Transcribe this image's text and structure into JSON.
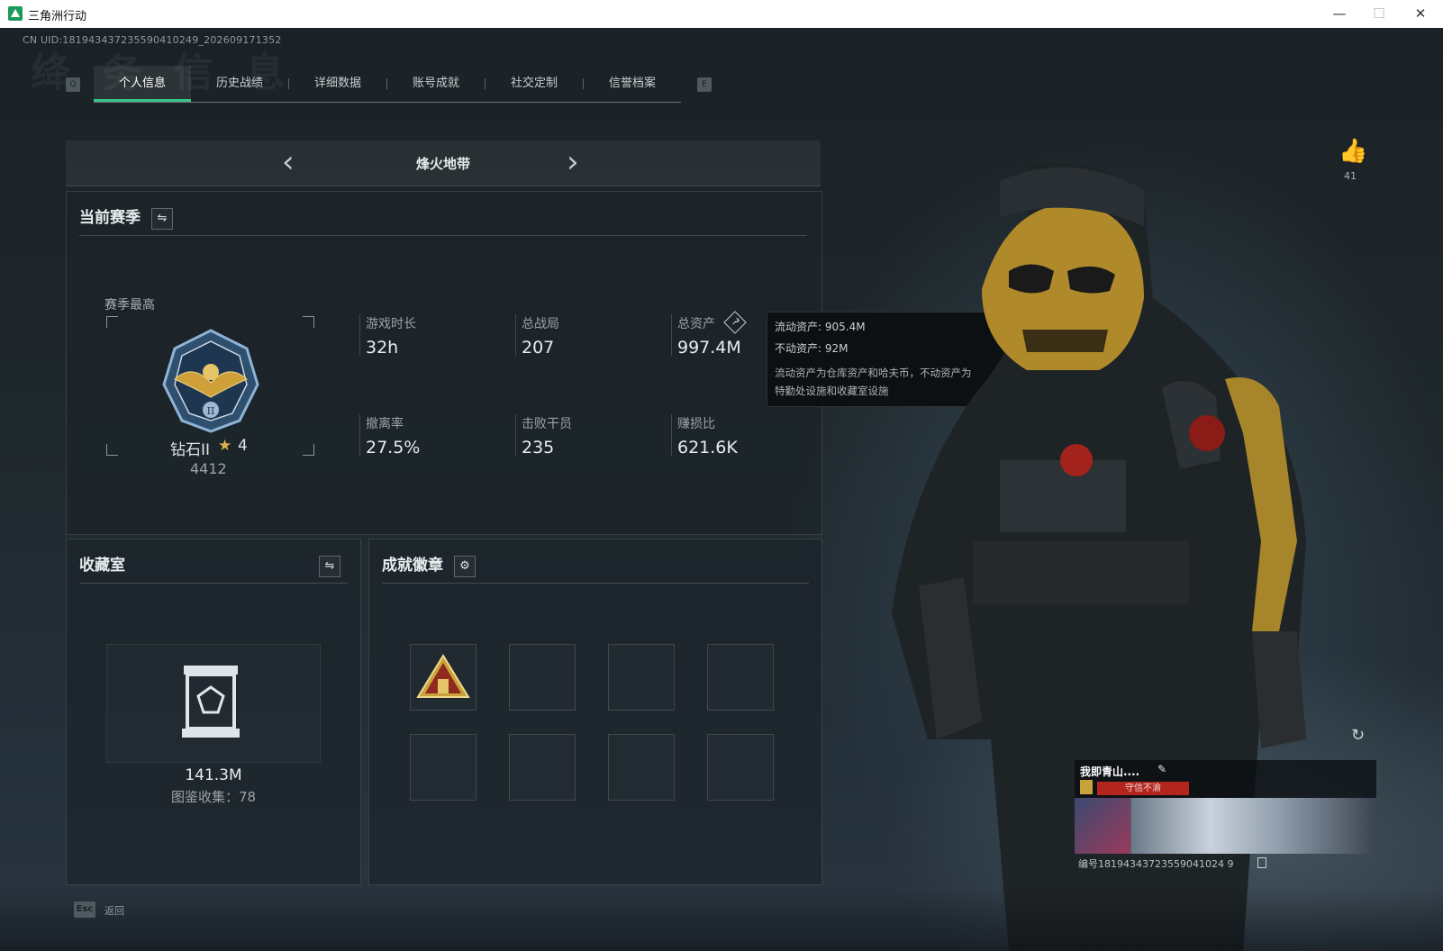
{
  "window": {
    "title": "三角洲行动",
    "minimize": "—",
    "maximize": "☐",
    "close": "✕"
  },
  "header": {
    "uid": "CN UID:1819434372355904102​49_202609171352"
  },
  "tabs": {
    "left_key": "Q",
    "right_key": "E",
    "items": [
      "个人信息",
      "历史战绩",
      "详细数据",
      "账号成就",
      "社交定制",
      "信誉档案"
    ],
    "active_index": 0
  },
  "mode": {
    "title": "烽火地带",
    "prev": "‹",
    "next": "›"
  },
  "season": {
    "title": "当前赛季",
    "switch_icon": "⇋",
    "rank_caption": "赛季最高",
    "rank_name": "钻石II",
    "rank_stars": "4",
    "rank_points": "4412",
    "stats": [
      {
        "label": "游戏时长",
        "value": "32h"
      },
      {
        "label": "总战局",
        "value": "207"
      },
      {
        "label": "总资产",
        "value": "997.4M"
      },
      {
        "label": "撤离率",
        "value": "27.5%"
      },
      {
        "label": "击败干员",
        "value": "235"
      },
      {
        "label": "赚损比",
        "value": "621.6K"
      }
    ],
    "help_icon": "?"
  },
  "tooltip": {
    "liquid": "流动资产: 905.4M",
    "fixed": "不动资产: 92M",
    "desc_line1": "流动资产为仓库资产和哈夫币，不动资产为",
    "desc_line2": "特勤处设施和收藏室设施"
  },
  "collection": {
    "title": "收藏室",
    "switch_icon": "⇋",
    "value": "141.3M",
    "count_label": "图鉴收集：78"
  },
  "badges": {
    "title": "成就徽章",
    "settings_icon": "⚙"
  },
  "likes": {
    "icon": "thumbs-up",
    "count": "41"
  },
  "player_card": {
    "name": "我即青山....",
    "tag": "守信不渝",
    "id": "编号18194343723559041024 9",
    "refresh_icon": "↻"
  },
  "footer": {
    "esc_key": "Esc",
    "esc_label": "返回"
  },
  "colors": {
    "accent": "#34c58a",
    "gold": "#c9a23a",
    "tag_red": "#b3261e"
  }
}
